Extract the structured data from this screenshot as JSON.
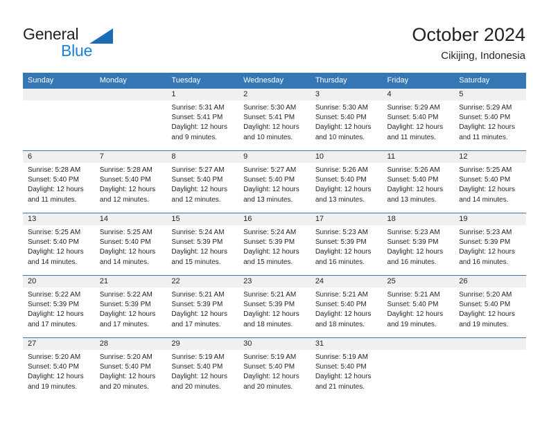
{
  "logo": {
    "text_primary": "General",
    "text_secondary": "Blue",
    "triangle_color": "#1b6cb5",
    "secondary_color": "#1b7fd4"
  },
  "header": {
    "title": "October 2024",
    "subtitle": "Cikijing, Indonesia"
  },
  "theme": {
    "header_blue": "#3576b4",
    "band_gray": "#f0f0f0",
    "text": "#231f20"
  },
  "weekdays": [
    "Sunday",
    "Monday",
    "Tuesday",
    "Wednesday",
    "Thursday",
    "Friday",
    "Saturday"
  ],
  "weeks": [
    [
      {
        "day": "",
        "empty": true,
        "sunrise": "",
        "sunset": "",
        "daylight1": "",
        "daylight2": ""
      },
      {
        "day": "",
        "empty": true,
        "sunrise": "",
        "sunset": "",
        "daylight1": "",
        "daylight2": ""
      },
      {
        "day": "1",
        "sunrise": "Sunrise: 5:31 AM",
        "sunset": "Sunset: 5:41 PM",
        "daylight1": "Daylight: 12 hours",
        "daylight2": "and 9 minutes."
      },
      {
        "day": "2",
        "sunrise": "Sunrise: 5:30 AM",
        "sunset": "Sunset: 5:41 PM",
        "daylight1": "Daylight: 12 hours",
        "daylight2": "and 10 minutes."
      },
      {
        "day": "3",
        "sunrise": "Sunrise: 5:30 AM",
        "sunset": "Sunset: 5:40 PM",
        "daylight1": "Daylight: 12 hours",
        "daylight2": "and 10 minutes."
      },
      {
        "day": "4",
        "sunrise": "Sunrise: 5:29 AM",
        "sunset": "Sunset: 5:40 PM",
        "daylight1": "Daylight: 12 hours",
        "daylight2": "and 11 minutes."
      },
      {
        "day": "5",
        "sunrise": "Sunrise: 5:29 AM",
        "sunset": "Sunset: 5:40 PM",
        "daylight1": "Daylight: 12 hours",
        "daylight2": "and 11 minutes."
      }
    ],
    [
      {
        "day": "6",
        "sunrise": "Sunrise: 5:28 AM",
        "sunset": "Sunset: 5:40 PM",
        "daylight1": "Daylight: 12 hours",
        "daylight2": "and 11 minutes."
      },
      {
        "day": "7",
        "sunrise": "Sunrise: 5:28 AM",
        "sunset": "Sunset: 5:40 PM",
        "daylight1": "Daylight: 12 hours",
        "daylight2": "and 12 minutes."
      },
      {
        "day": "8",
        "sunrise": "Sunrise: 5:27 AM",
        "sunset": "Sunset: 5:40 PM",
        "daylight1": "Daylight: 12 hours",
        "daylight2": "and 12 minutes."
      },
      {
        "day": "9",
        "sunrise": "Sunrise: 5:27 AM",
        "sunset": "Sunset: 5:40 PM",
        "daylight1": "Daylight: 12 hours",
        "daylight2": "and 13 minutes."
      },
      {
        "day": "10",
        "sunrise": "Sunrise: 5:26 AM",
        "sunset": "Sunset: 5:40 PM",
        "daylight1": "Daylight: 12 hours",
        "daylight2": "and 13 minutes."
      },
      {
        "day": "11",
        "sunrise": "Sunrise: 5:26 AM",
        "sunset": "Sunset: 5:40 PM",
        "daylight1": "Daylight: 12 hours",
        "daylight2": "and 13 minutes."
      },
      {
        "day": "12",
        "sunrise": "Sunrise: 5:25 AM",
        "sunset": "Sunset: 5:40 PM",
        "daylight1": "Daylight: 12 hours",
        "daylight2": "and 14 minutes."
      }
    ],
    [
      {
        "day": "13",
        "sunrise": "Sunrise: 5:25 AM",
        "sunset": "Sunset: 5:40 PM",
        "daylight1": "Daylight: 12 hours",
        "daylight2": "and 14 minutes."
      },
      {
        "day": "14",
        "sunrise": "Sunrise: 5:25 AM",
        "sunset": "Sunset: 5:40 PM",
        "daylight1": "Daylight: 12 hours",
        "daylight2": "and 14 minutes."
      },
      {
        "day": "15",
        "sunrise": "Sunrise: 5:24 AM",
        "sunset": "Sunset: 5:39 PM",
        "daylight1": "Daylight: 12 hours",
        "daylight2": "and 15 minutes."
      },
      {
        "day": "16",
        "sunrise": "Sunrise: 5:24 AM",
        "sunset": "Sunset: 5:39 PM",
        "daylight1": "Daylight: 12 hours",
        "daylight2": "and 15 minutes."
      },
      {
        "day": "17",
        "sunrise": "Sunrise: 5:23 AM",
        "sunset": "Sunset: 5:39 PM",
        "daylight1": "Daylight: 12 hours",
        "daylight2": "and 16 minutes."
      },
      {
        "day": "18",
        "sunrise": "Sunrise: 5:23 AM",
        "sunset": "Sunset: 5:39 PM",
        "daylight1": "Daylight: 12 hours",
        "daylight2": "and 16 minutes."
      },
      {
        "day": "19",
        "sunrise": "Sunrise: 5:23 AM",
        "sunset": "Sunset: 5:39 PM",
        "daylight1": "Daylight: 12 hours",
        "daylight2": "and 16 minutes."
      }
    ],
    [
      {
        "day": "20",
        "sunrise": "Sunrise: 5:22 AM",
        "sunset": "Sunset: 5:39 PM",
        "daylight1": "Daylight: 12 hours",
        "daylight2": "and 17 minutes."
      },
      {
        "day": "21",
        "sunrise": "Sunrise: 5:22 AM",
        "sunset": "Sunset: 5:39 PM",
        "daylight1": "Daylight: 12 hours",
        "daylight2": "and 17 minutes."
      },
      {
        "day": "22",
        "sunrise": "Sunrise: 5:21 AM",
        "sunset": "Sunset: 5:39 PM",
        "daylight1": "Daylight: 12 hours",
        "daylight2": "and 17 minutes."
      },
      {
        "day": "23",
        "sunrise": "Sunrise: 5:21 AM",
        "sunset": "Sunset: 5:39 PM",
        "daylight1": "Daylight: 12 hours",
        "daylight2": "and 18 minutes."
      },
      {
        "day": "24",
        "sunrise": "Sunrise: 5:21 AM",
        "sunset": "Sunset: 5:40 PM",
        "daylight1": "Daylight: 12 hours",
        "daylight2": "and 18 minutes."
      },
      {
        "day": "25",
        "sunrise": "Sunrise: 5:21 AM",
        "sunset": "Sunset: 5:40 PM",
        "daylight1": "Daylight: 12 hours",
        "daylight2": "and 19 minutes."
      },
      {
        "day": "26",
        "sunrise": "Sunrise: 5:20 AM",
        "sunset": "Sunset: 5:40 PM",
        "daylight1": "Daylight: 12 hours",
        "daylight2": "and 19 minutes."
      }
    ],
    [
      {
        "day": "27",
        "sunrise": "Sunrise: 5:20 AM",
        "sunset": "Sunset: 5:40 PM",
        "daylight1": "Daylight: 12 hours",
        "daylight2": "and 19 minutes."
      },
      {
        "day": "28",
        "sunrise": "Sunrise: 5:20 AM",
        "sunset": "Sunset: 5:40 PM",
        "daylight1": "Daylight: 12 hours",
        "daylight2": "and 20 minutes."
      },
      {
        "day": "29",
        "sunrise": "Sunrise: 5:19 AM",
        "sunset": "Sunset: 5:40 PM",
        "daylight1": "Daylight: 12 hours",
        "daylight2": "and 20 minutes."
      },
      {
        "day": "30",
        "sunrise": "Sunrise: 5:19 AM",
        "sunset": "Sunset: 5:40 PM",
        "daylight1": "Daylight: 12 hours",
        "daylight2": "and 20 minutes."
      },
      {
        "day": "31",
        "sunrise": "Sunrise: 5:19 AM",
        "sunset": "Sunset: 5:40 PM",
        "daylight1": "Daylight: 12 hours",
        "daylight2": "and 21 minutes."
      },
      {
        "day": "",
        "empty": true,
        "sunrise": "",
        "sunset": "",
        "daylight1": "",
        "daylight2": ""
      },
      {
        "day": "",
        "empty": true,
        "sunrise": "",
        "sunset": "",
        "daylight1": "",
        "daylight2": ""
      }
    ]
  ]
}
